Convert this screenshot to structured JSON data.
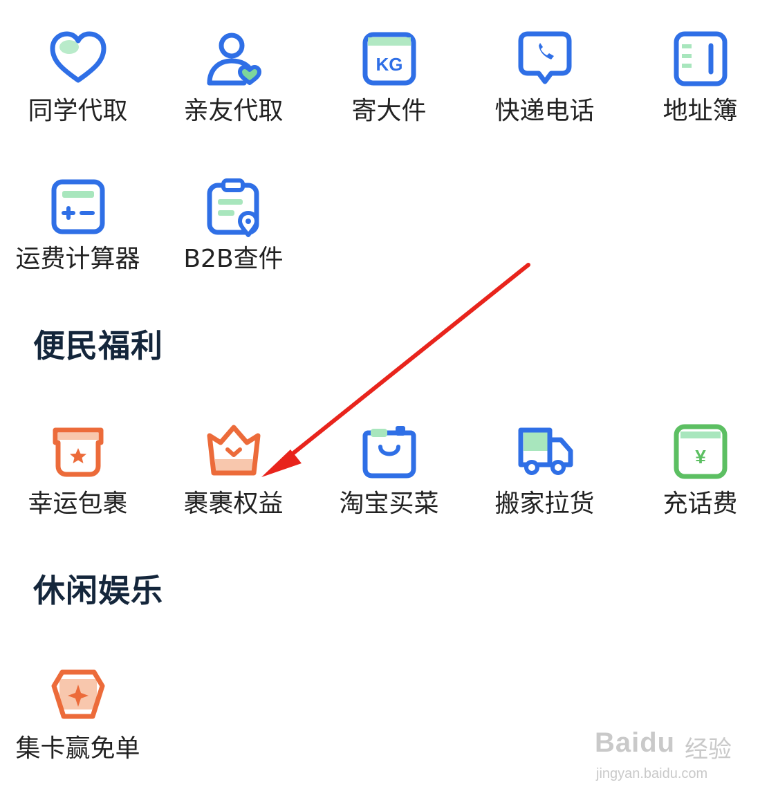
{
  "rows": {
    "row1": [
      {
        "label": "同学代取",
        "icon": "heart-icon"
      },
      {
        "label": "亲友代取",
        "icon": "person-heart-icon"
      },
      {
        "label": "寄大件",
        "icon": "kg-box-icon",
        "icon_text": "KG"
      },
      {
        "label": "快递电话",
        "icon": "phone-bubble-icon"
      },
      {
        "label": "地址簿",
        "icon": "address-book-icon"
      }
    ],
    "row2": [
      {
        "label": "运费计算器",
        "icon": "calculator-icon"
      },
      {
        "label": "B2B查件",
        "icon": "clipboard-location-icon"
      }
    ]
  },
  "sections": {
    "welfare": {
      "title": "便民福利",
      "items": [
        {
          "label": "幸运包裹",
          "icon": "star-box-icon"
        },
        {
          "label": "裹裹权益",
          "icon": "crown-icon"
        },
        {
          "label": "淘宝买菜",
          "icon": "shopping-bag-icon"
        },
        {
          "label": "搬家拉货",
          "icon": "truck-icon"
        },
        {
          "label": "充话费",
          "icon": "yen-card-icon",
          "icon_text": "¥"
        }
      ]
    },
    "leisure": {
      "title": "休闲娱乐",
      "items": [
        {
          "label": "集卡赢免单",
          "icon": "card-sparkle-icon"
        }
      ]
    }
  },
  "watermark": {
    "logo": "Baidu",
    "subtitle": "经验",
    "url": "jingyan.baidu.com"
  },
  "colors": {
    "blue": "#2f6fe6",
    "green": "#7ed69a",
    "orange": "#ec6b3a",
    "peach": "#f8c7ad",
    "charge_green": "#5cbf62",
    "arrow_red": "#e8241c",
    "label": "#222222",
    "section_title": "#14263b"
  }
}
